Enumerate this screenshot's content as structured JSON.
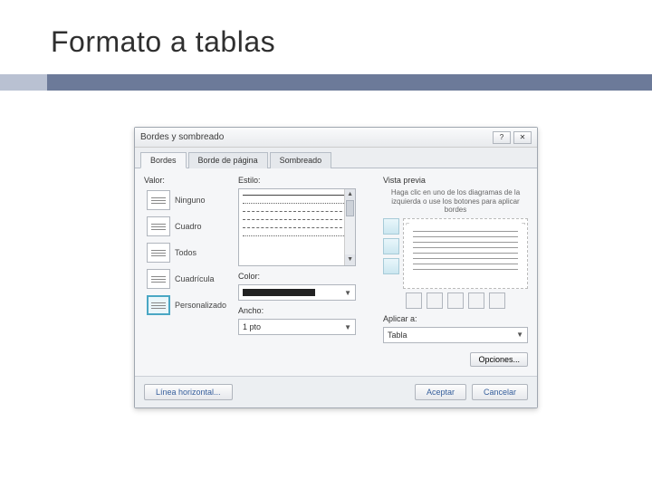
{
  "slide": {
    "title": "Formato a tablas"
  },
  "dialog": {
    "title": "Bordes y sombreado",
    "help_btn": "?",
    "close_btn": "✕",
    "tabs": [
      {
        "label": "Bordes",
        "active": true
      },
      {
        "label": "Borde de página",
        "active": false
      },
      {
        "label": "Sombreado",
        "active": false
      }
    ],
    "valor": {
      "label": "Valor:",
      "items": [
        {
          "text": "Ninguno"
        },
        {
          "text": "Cuadro"
        },
        {
          "text": "Todos"
        },
        {
          "text": "Cuadrícula"
        },
        {
          "text": "Personalizado",
          "selected": true
        }
      ]
    },
    "estilo": {
      "label": "Estilo:"
    },
    "color": {
      "label": "Color:"
    },
    "ancho": {
      "label": "Ancho:",
      "value": "1 pto"
    },
    "vista": {
      "label": "Vista previa",
      "hint": "Haga clic en uno de los diagramas de la izquierda o use los botones para aplicar bordes"
    },
    "aplicar": {
      "label": "Aplicar a:",
      "value": "Tabla"
    },
    "opciones": "Opciones...",
    "footer": {
      "hline": "Línea horizontal...",
      "ok": "Aceptar",
      "cancel": "Cancelar"
    }
  }
}
